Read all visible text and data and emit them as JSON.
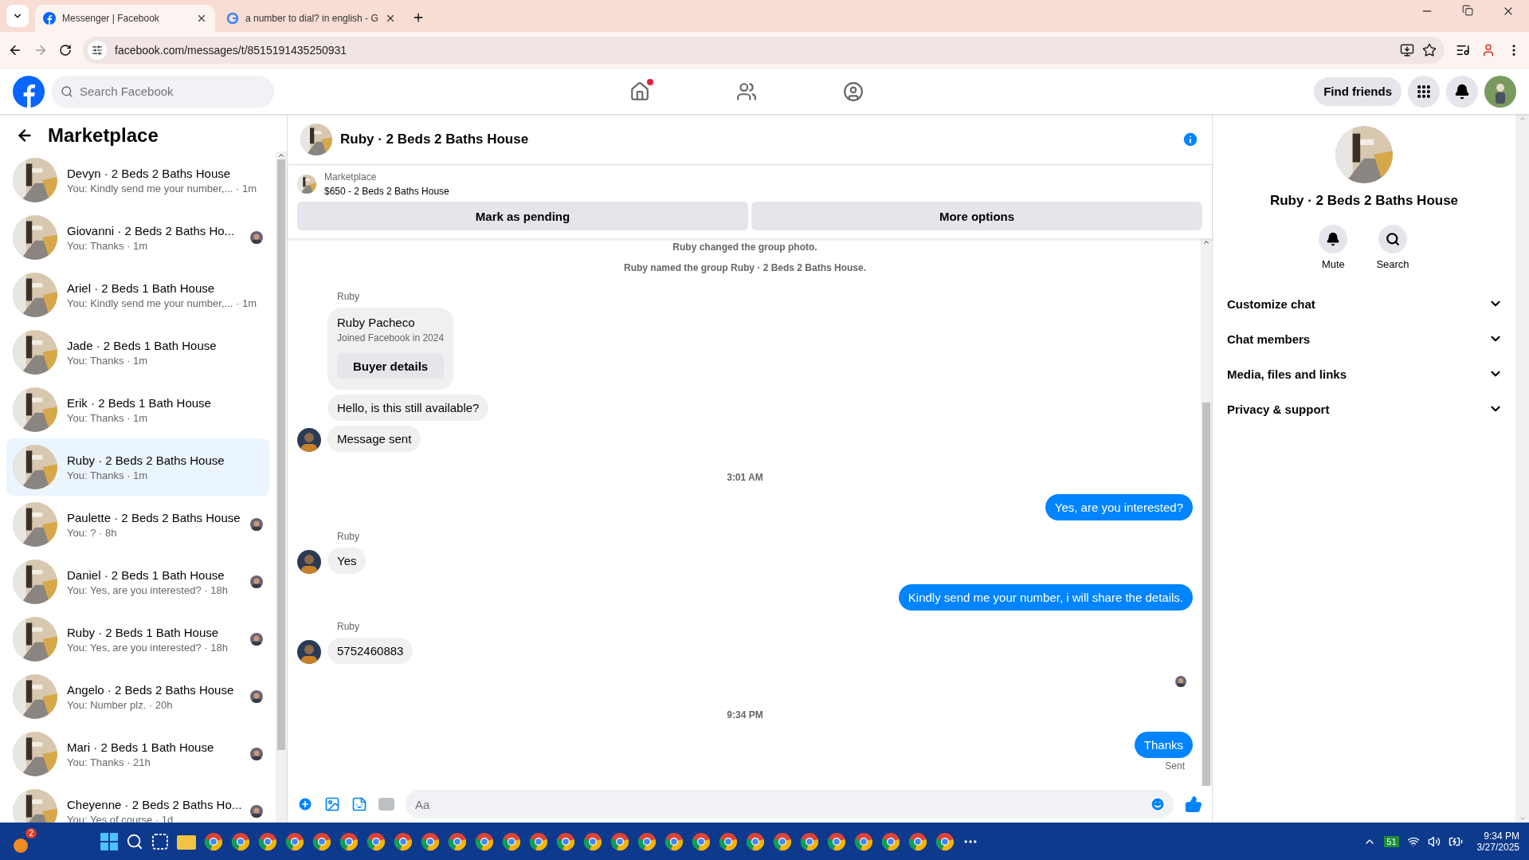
{
  "browser": {
    "tabs": [
      {
        "title": "Messenger | Facebook",
        "selected": true
      },
      {
        "title": "a number to dial? in english - G",
        "selected": false
      }
    ],
    "url": "facebook.com/messages/t/8515191435250931"
  },
  "header": {
    "search_placeholder": "Search Facebook",
    "find_friends": "Find friends"
  },
  "sidebar": {
    "title": "Marketplace",
    "conversations": [
      {
        "name": "Devyn · 2 Beds 2 Baths House",
        "preview": "You: Kindly send me your number,... · 1m",
        "selected": false,
        "seen": false
      },
      {
        "name": "Giovanni · 2 Beds 2 Baths Ho...",
        "preview": "You: Thanks · 1m",
        "selected": false,
        "seen": true
      },
      {
        "name": "Ariel · 2 Beds 1 Bath House",
        "preview": "You: Kindly send me your number,... · 1m",
        "selected": false,
        "seen": false
      },
      {
        "name": "Jade · 2 Beds 1 Bath House",
        "preview": "You: Thanks · 1m",
        "selected": false,
        "seen": false
      },
      {
        "name": "Erik · 2 Beds 1 Bath House",
        "preview": "You: Thanks · 1m",
        "selected": false,
        "seen": false
      },
      {
        "name": "Ruby · 2 Beds 2 Baths House",
        "preview": "You: Thanks · 1m",
        "selected": true,
        "seen": false
      },
      {
        "name": "Paulette · 2 Beds 2 Baths House",
        "preview": "You: ? · 8h",
        "selected": false,
        "seen": true
      },
      {
        "name": "Daniel · 2 Beds 1 Bath House",
        "preview": "You: Yes, are you interested? · 18h",
        "selected": false,
        "seen": true
      },
      {
        "name": "Ruby · 2 Beds 1 Bath House",
        "preview": "You: Yes, are you interested? · 18h",
        "selected": false,
        "seen": true
      },
      {
        "name": "Angelo · 2 Beds 2 Baths House",
        "preview": "You: Number plz. · 20h",
        "selected": false,
        "seen": true
      },
      {
        "name": "Mari · 2 Beds 1 Bath House",
        "preview": "You: Thanks · 21h",
        "selected": false,
        "seen": true
      },
      {
        "name": "Cheyenne · 2 Beds 2 Baths Ho...",
        "preview": "You: Yes of course · 1d",
        "selected": false,
        "seen": true
      }
    ]
  },
  "chat": {
    "title": "Ruby · 2 Beds 2 Baths House",
    "listing": {
      "label": "Marketplace",
      "line": "$650 - 2 Beds 2 Baths House"
    },
    "actions": [
      "Mark as pending",
      "More options"
    ],
    "messages": [
      {
        "kind": "system",
        "text": "Ruby changed the group photo."
      },
      {
        "kind": "system",
        "text": "Ruby named the group Ruby · 2 Beds 2 Baths House."
      },
      {
        "kind": "sender",
        "text": "Ruby"
      },
      {
        "kind": "card",
        "name": "Ruby Pacheco",
        "text": "Joined Facebook in 2024",
        "button": "Buyer details"
      },
      {
        "kind": "incoming",
        "text": "Hello, is this still available?",
        "avatar": false
      },
      {
        "kind": "incoming",
        "text": "Message sent",
        "avatar": true
      },
      {
        "kind": "time",
        "text": "3:01 AM"
      },
      {
        "kind": "outgoing",
        "text": "Yes, are you interested?"
      },
      {
        "kind": "sender",
        "text": "Ruby"
      },
      {
        "kind": "incoming",
        "text": "Yes",
        "avatar": true
      },
      {
        "kind": "outgoing",
        "text": "Kindly send me your number, i will share the details."
      },
      {
        "kind": "sender",
        "text": "Ruby"
      },
      {
        "kind": "incoming",
        "text": "5752460883",
        "avatar": true
      },
      {
        "kind": "seen"
      },
      {
        "kind": "time",
        "text": "9:34 PM"
      },
      {
        "kind": "outgoing",
        "text": "Thanks"
      },
      {
        "kind": "status",
        "text": "Sent"
      }
    ],
    "composer": {
      "placeholder": "Aa"
    }
  },
  "details": {
    "title": "Ruby · 2 Beds 2 Baths House",
    "actions": [
      {
        "kind": "mute",
        "label": "Mute"
      },
      {
        "kind": "search",
        "label": "Search"
      }
    ],
    "sections": [
      "Customize chat",
      "Chat members",
      "Media, files and links",
      "Privacy & support"
    ]
  },
  "taskbar": {
    "badge": "2",
    "tray_badge": "51",
    "time": "9:34 PM",
    "date": "3/27/2025"
  }
}
